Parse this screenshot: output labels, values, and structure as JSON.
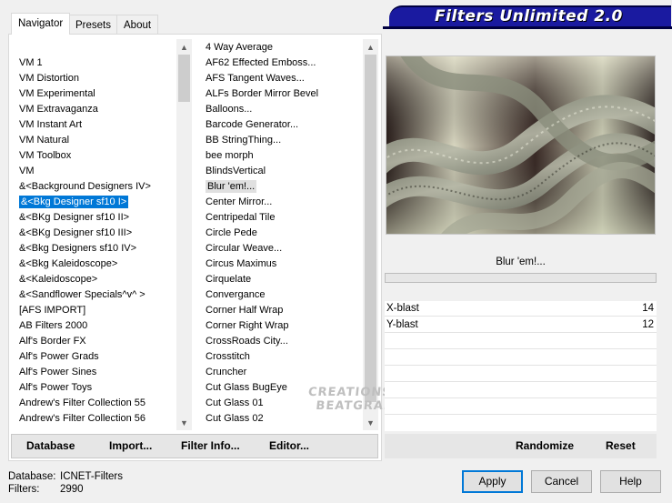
{
  "tabs": [
    {
      "label": "Navigator",
      "active": true
    },
    {
      "label": "Presets",
      "active": false
    },
    {
      "label": "About",
      "active": false
    }
  ],
  "banner": {
    "title": "Filters Unlimited 2.0"
  },
  "categories": [
    "VM 1",
    "VM Distortion",
    "VM Experimental",
    "VM Extravaganza",
    "VM Instant Art",
    "VM Natural",
    "VM Toolbox",
    "VM",
    "&<Background Designers IV>",
    "&<Bkg Designer sf10 I>",
    "&<BKg Designer sf10 II>",
    "&<BKg Designer sf10 III>",
    "&<Bkg Designers sf10 IV>",
    "&<Bkg Kaleidoscope>",
    "&<Kaleidoscope>",
    "&<Sandflower Specials^v^ >",
    "[AFS IMPORT]",
    "AB Filters 2000",
    "Alf's Border FX",
    "Alf's Power Grads",
    "Alf's Power Sines",
    "Alf's Power Toys",
    "Andrew's Filter Collection 55",
    "Andrew's Filter Collection 56"
  ],
  "selected_category_index": 9,
  "filters": [
    "4 Way Average",
    "AF62 Effected Emboss...",
    "AFS Tangent Waves...",
    "ALFs Border Mirror Bevel",
    "Balloons...",
    "Barcode Generator...",
    "BB StringThing...",
    "bee morph",
    "BlindsVertical",
    "Blur 'em!...",
    "Center Mirror...",
    "Centripedal Tile",
    "Circle Pede",
    "Circular Weave...",
    "Circus Maximus",
    "Cirquelate",
    "Convergance",
    "Corner Half Wrap",
    "Corner Right Wrap",
    "CrossRoads City...",
    "Crosstitch",
    "Cruncher",
    "Cut Glass  BugEye",
    "Cut Glass 01",
    "Cut Glass 02"
  ],
  "selected_filter_index": 9,
  "toolbar": {
    "database": "Database",
    "import": "Import...",
    "filter_info": "Filter Info...",
    "editor": "Editor..."
  },
  "current_filter": "Blur 'em!...",
  "params": [
    {
      "label": "X-blast",
      "value": "14"
    },
    {
      "label": "Y-blast",
      "value": "12"
    }
  ],
  "right_toolbar": {
    "randomize": "Randomize",
    "reset": "Reset"
  },
  "status": {
    "database_label": "Database:",
    "database_value": "ICNET-Filters",
    "filters_label": "Filters:",
    "filters_value": "2990"
  },
  "dialog_buttons": {
    "apply": "Apply",
    "cancel": "Cancel",
    "help": "Help"
  },
  "watermark": {
    "line1": "CREATIONS",
    "line2": "BEATGRAPH"
  },
  "colors": {
    "selection": "#0078d7",
    "banner": "#1a1aa0"
  }
}
